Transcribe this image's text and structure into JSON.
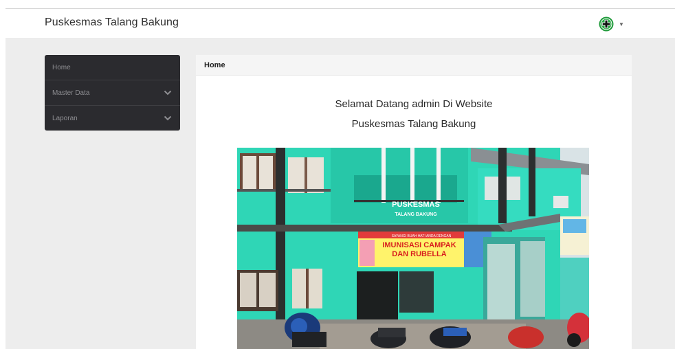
{
  "navbar": {
    "brand": "Puskesmas Talang Bakung",
    "user_menu_icon": "green-cross-logo-icon",
    "caret_icon": "caret-down-icon"
  },
  "sidebar": {
    "items": [
      {
        "label": "Home",
        "expandable": false
      },
      {
        "label": "Master Data",
        "expandable": true
      },
      {
        "label": "Laporan",
        "expandable": true
      }
    ]
  },
  "panel": {
    "heading": "Home",
    "welcome_line_1": "Selamat Datang admin Di Website",
    "welcome_line_2": "Puskesmas Talang Bakung",
    "photo": {
      "building_sign_1": "PUSKESMAS",
      "building_sign_2": "TALANG BAKUNG",
      "banner_top": "SAYANGI BUAH HATI ANDA DENGAN",
      "banner_line_1": "IMUNISASI CAMPAK",
      "banner_line_2": "DAN RUBELLA"
    }
  },
  "colors": {
    "sidebar_bg": "#2b2b2f",
    "sidebar_text": "#8e8e92",
    "page_bg": "#ededed",
    "building_teal": "#2fd6b6",
    "logo_green": "#1f9a3a"
  }
}
